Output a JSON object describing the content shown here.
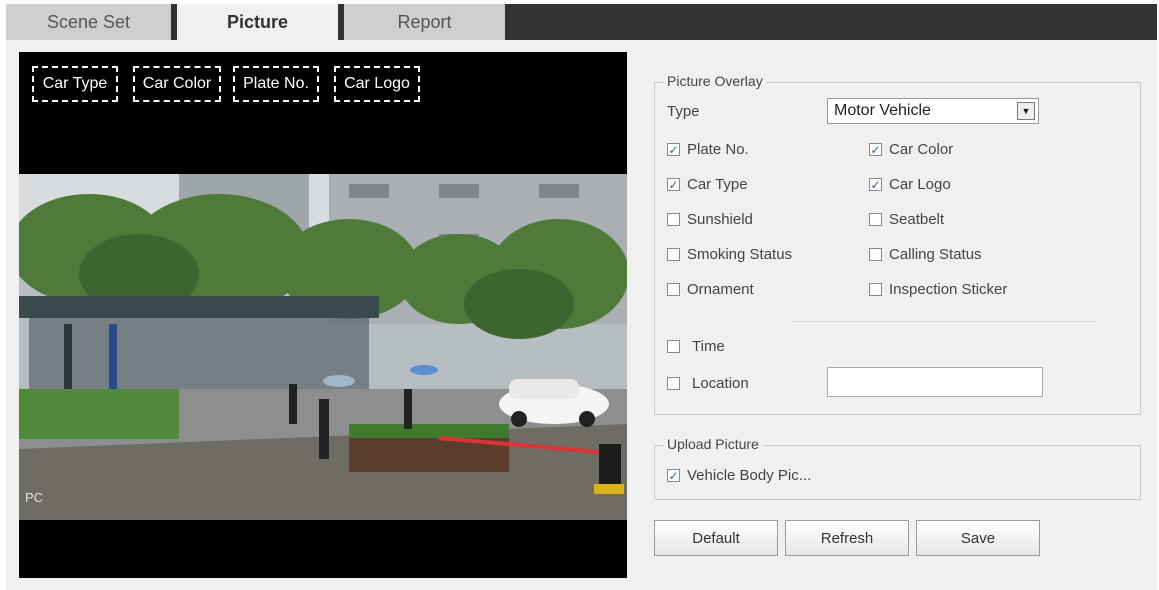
{
  "tabs": [
    {
      "label": "Scene Set",
      "active": false
    },
    {
      "label": "Picture",
      "active": true
    },
    {
      "label": "Report",
      "active": false
    }
  ],
  "video": {
    "overlay_labels": [
      "Car Type",
      "Car Color",
      "Plate No.",
      "Car Logo"
    ],
    "corner_text": "PC"
  },
  "picture_overlay": {
    "legend": "Picture Overlay",
    "type_label": "Type",
    "type_value": "Motor Vehicle",
    "checkboxes": [
      {
        "label": "Plate No.",
        "checked": true
      },
      {
        "label": "Car Color",
        "checked": true
      },
      {
        "label": "Car Type",
        "checked": true
      },
      {
        "label": "Car Logo",
        "checked": true
      },
      {
        "label": "Sunshield",
        "checked": false
      },
      {
        "label": "Seatbelt",
        "checked": false
      },
      {
        "label": "Smoking Status",
        "checked": false
      },
      {
        "label": "Calling Status",
        "checked": false
      },
      {
        "label": "Ornament",
        "checked": false
      },
      {
        "label": "Inspection Sticker",
        "checked": false
      }
    ],
    "time": {
      "label": "Time",
      "checked": false
    },
    "location": {
      "label": "Location",
      "checked": false,
      "value": ""
    }
  },
  "upload_picture": {
    "legend": "Upload Picture",
    "vehicle_body": {
      "label": "Vehicle Body Pic...",
      "checked": true
    }
  },
  "buttons": {
    "default": "Default",
    "refresh": "Refresh",
    "save": "Save"
  },
  "colors": {
    "tabbar": "#333333",
    "active_tab": "#f0f0f0",
    "inactive_tab": "#cfcfcf",
    "panel_bg": "#f0f0f0",
    "check_mark": "#2b5fb0"
  }
}
